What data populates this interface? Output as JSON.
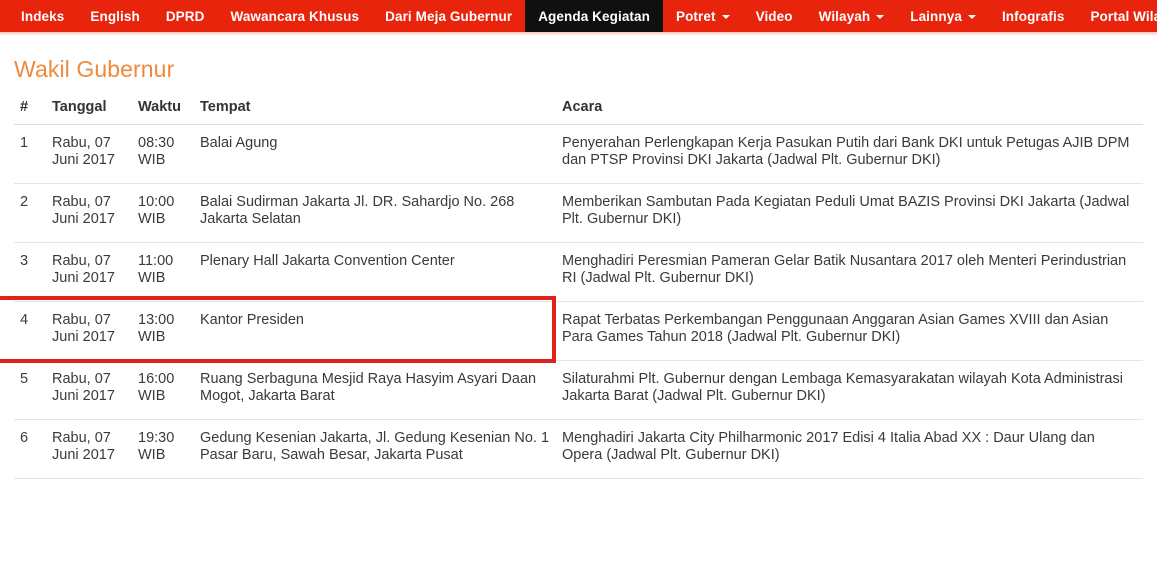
{
  "nav": {
    "items": [
      {
        "label": "Indeks",
        "active": false,
        "caret": false
      },
      {
        "label": "English",
        "active": false,
        "caret": false
      },
      {
        "label": "DPRD",
        "active": false,
        "caret": false
      },
      {
        "label": "Wawancara Khusus",
        "active": false,
        "caret": false
      },
      {
        "label": "Dari Meja Gubernur",
        "active": false,
        "caret": false
      },
      {
        "label": "Agenda Kegiatan",
        "active": true,
        "caret": false
      },
      {
        "label": "Potret",
        "active": false,
        "caret": true
      },
      {
        "label": "Video",
        "active": false,
        "caret": false
      },
      {
        "label": "Wilayah",
        "active": false,
        "caret": true
      },
      {
        "label": "Lainnya",
        "active": false,
        "caret": true
      },
      {
        "label": "Infografis",
        "active": false,
        "caret": false
      },
      {
        "label": "Portal Wilayah",
        "active": false,
        "caret": true
      }
    ]
  },
  "page": {
    "title": "Wakil Gubernur"
  },
  "table": {
    "headers": {
      "num": "#",
      "tanggal": "Tanggal",
      "waktu": "Waktu",
      "tempat": "Tempat",
      "acara": "Acara"
    },
    "rows": [
      {
        "num": "1",
        "tanggal": "Rabu, 07 Juni 2017",
        "waktu": "08:30 WIB",
        "tempat": "Balai Agung",
        "acara": "Penyerahan Perlengkapan Kerja Pasukan Putih dari Bank DKI untuk Petugas AJIB DPM dan PTSP Provinsi DKI Jakarta (Jadwal Plt. Gubernur DKI)"
      },
      {
        "num": "2",
        "tanggal": "Rabu, 07 Juni 2017",
        "waktu": "10:00 WIB",
        "tempat": "Balai Sudirman Jakarta Jl. DR. Sahardjo No. 268 Jakarta Selatan",
        "acara": "Memberikan Sambutan Pada Kegiatan Peduli Umat BAZIS Provinsi DKI Jakarta (Jadwal Plt. Gubernur DKI)"
      },
      {
        "num": "3",
        "tanggal": "Rabu, 07 Juni 2017",
        "waktu": "11:00 WIB",
        "tempat": "Plenary Hall Jakarta Convention Center",
        "acara": "Menghadiri Peresmian Pameran Gelar Batik Nusantara 2017 oleh Menteri Perindustrian RI (Jadwal Plt. Gubernur DKI)"
      },
      {
        "num": "4",
        "tanggal": "Rabu, 07 Juni 2017",
        "waktu": "13:00 WIB",
        "tempat": "Kantor Presiden",
        "acara": "Rapat Terbatas Perkembangan Penggunaan Anggaran Asian Games XVIII dan Asian Para Games Tahun 2018 (Jadwal Plt. Gubernur DKI)"
      },
      {
        "num": "5",
        "tanggal": "Rabu, 07 Juni 2017",
        "waktu": "16:00 WIB",
        "tempat": "Ruang Serbaguna Mesjid Raya Hasyim Asyari Daan Mogot, Jakarta Barat",
        "acara": "Silaturahmi Plt. Gubernur dengan Lembaga Kemasyarakatan wilayah Kota Administrasi Jakarta Barat (Jadwal Plt. Gubernur DKI)"
      },
      {
        "num": "6",
        "tanggal": "Rabu, 07 Juni 2017",
        "waktu": "19:30 WIB",
        "tempat": "Gedung Kesenian Jakarta, Jl. Gedung Kesenian No. 1 Pasar Baru, Sawah Besar, Jakarta Pusat",
        "acara": "Menghadiri Jakarta City Philharmonic 2017 Edisi 4 Italia Abad XX : Daur Ulang dan Opera (Jadwal Plt. Gubernur DKI)"
      }
    ]
  },
  "annotation": {
    "highlighted_row_index": 3,
    "color": "#e0231a"
  },
  "colors": {
    "nav_background": "#e8240c",
    "nav_active_background": "#101010",
    "title": "#f0893b",
    "text": "#333333"
  }
}
